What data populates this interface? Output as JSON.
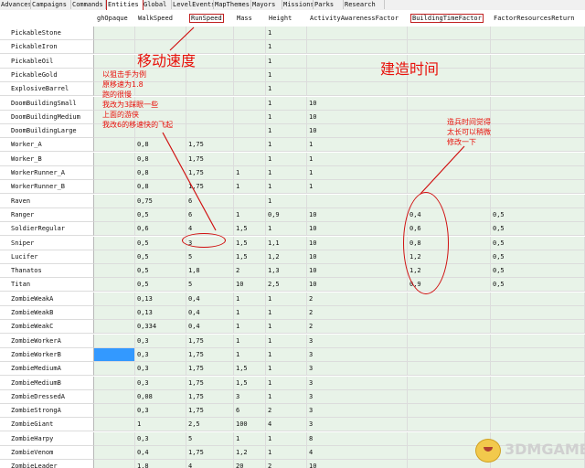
{
  "tabs": [
    "Advances",
    "Campaigns",
    "Commands",
    "Entities",
    "Global",
    "LevelEvents",
    "MapThemes",
    "Mayors",
    "Missions",
    "Parks",
    "Research"
  ],
  "active_tab": "Entities",
  "columns": [
    "ghOpaque",
    "WalkSpeed",
    "RunSpeed",
    "Mass",
    "Height",
    "ActivityAwarenessFactor",
    "BuildingTimeFactor",
    "FactorResourcesReturn"
  ],
  "rows": [
    {
      "name": "PickableStone",
      "values": [
        "",
        "",
        "",
        "",
        "1",
        "",
        "",
        ""
      ]
    },
    {
      "name": "PickableIron",
      "values": [
        "",
        "",
        "",
        "",
        "1",
        "",
        "",
        ""
      ]
    },
    {
      "name": "PickableOil",
      "values": [
        "",
        "",
        "",
        "",
        "1",
        "",
        "",
        ""
      ]
    },
    {
      "name": "PickableGold",
      "values": [
        "",
        "",
        "",
        "",
        "1",
        "",
        "",
        ""
      ]
    },
    {
      "name": "ExplosiveBarrel",
      "values": [
        "",
        "",
        "",
        "",
        "1",
        "",
        "",
        ""
      ]
    },
    {
      "name": "DoomBuildingSmall",
      "values": [
        "",
        "",
        "",
        "",
        "1",
        "10",
        "",
        ""
      ]
    },
    {
      "name": "DoomBuildingMedium",
      "values": [
        "",
        "",
        "",
        "",
        "1",
        "10",
        "",
        ""
      ]
    },
    {
      "name": "DoomBuildingLarge",
      "values": [
        "",
        "",
        "",
        "",
        "1",
        "10",
        "",
        ""
      ]
    },
    {
      "name": "Worker_A",
      "values": [
        "",
        "0,8",
        "1,75",
        "",
        "1",
        "1",
        "",
        ""
      ]
    },
    {
      "name": "Worker_B",
      "values": [
        "",
        "0,8",
        "1,75",
        "",
        "1",
        "1",
        "",
        ""
      ]
    },
    {
      "name": "WorkerRunner_A",
      "values": [
        "",
        "0,8",
        "1,75",
        "1",
        "1",
        "1",
        "",
        ""
      ]
    },
    {
      "name": "WorkerRunner_B",
      "values": [
        "",
        "0,8",
        "1,75",
        "1",
        "1",
        "1",
        "",
        ""
      ]
    },
    {
      "name": "Raven",
      "values": [
        "",
        "0,75",
        "6",
        "",
        "1",
        "",
        "",
        ""
      ]
    },
    {
      "name": "Ranger",
      "values": [
        "",
        "0,5",
        "6",
        "1",
        "0,9",
        "10",
        "0,4",
        "0,5"
      ]
    },
    {
      "name": "SoldierRegular",
      "values": [
        "",
        "0,6",
        "4",
        "1,5",
        "1",
        "10",
        "0,6",
        "0,5"
      ]
    },
    {
      "name": "Sniper",
      "values": [
        "",
        "0,5",
        "3",
        "1,5",
        "1,1",
        "10",
        "0,8",
        "0,5"
      ]
    },
    {
      "name": "Lucifer",
      "values": [
        "",
        "0,5",
        "5",
        "1,5",
        "1,2",
        "10",
        "1,2",
        "0,5"
      ]
    },
    {
      "name": "Thanatos",
      "values": [
        "",
        "0,5",
        "1,8",
        "2",
        "1,3",
        "10",
        "1,2",
        "0,5"
      ]
    },
    {
      "name": "Titan",
      "values": [
        "",
        "0,5",
        "5",
        "10",
        "2,5",
        "10",
        "0,9",
        "0,5"
      ]
    },
    {
      "name": "ZombieWeakA",
      "values": [
        "",
        "0,13",
        "0,4",
        "1",
        "1",
        "2",
        "",
        ""
      ]
    },
    {
      "name": "ZombieWeakB",
      "values": [
        "",
        "0,13",
        "0,4",
        "1",
        "1",
        "2",
        "",
        ""
      ]
    },
    {
      "name": "ZombieWeakC",
      "values": [
        "",
        "0,334",
        "0,4",
        "1",
        "1",
        "2",
        "",
        ""
      ]
    },
    {
      "name": "ZombieWorkerA",
      "values": [
        "",
        "0,3",
        "1,75",
        "1",
        "1",
        "3",
        "",
        ""
      ]
    },
    {
      "name": "ZombieWorkerB",
      "values": [
        "",
        "0,3",
        "1,75",
        "1",
        "1",
        "3",
        "",
        ""
      ]
    },
    {
      "name": "ZombieMediumA",
      "values": [
        "",
        "0,3",
        "1,75",
        "1,5",
        "1",
        "3",
        "",
        ""
      ]
    },
    {
      "name": "ZombieMediumB",
      "values": [
        "",
        "0,3",
        "1,75",
        "1,5",
        "1",
        "3",
        "",
        ""
      ]
    },
    {
      "name": "ZombieDressedA",
      "values": [
        "",
        "0,08",
        "1,75",
        "3",
        "1",
        "3",
        "",
        ""
      ]
    },
    {
      "name": "ZombieStrongA",
      "values": [
        "",
        "0,3",
        "1,75",
        "6",
        "2",
        "3",
        "",
        ""
      ]
    },
    {
      "name": "ZombieGiant",
      "values": [
        "",
        "1",
        "2,5",
        "100",
        "4",
        "3",
        "",
        ""
      ]
    },
    {
      "name": "ZombieHarpy",
      "values": [
        "",
        "0,3",
        "5",
        "1",
        "1",
        "8",
        "",
        ""
      ]
    },
    {
      "name": "ZombieVenom",
      "values": [
        "",
        "0,4",
        "1,75",
        "1,2",
        "1",
        "4",
        "",
        ""
      ]
    },
    {
      "name": "ZombieLeader",
      "values": [
        "",
        "1,8",
        "4",
        "20",
        "2",
        "10",
        "",
        ""
      ]
    }
  ],
  "selected_row": "ZombieWorkerB",
  "annotations": {
    "runspeed_title": "移动速度",
    "buildtime_title": "建造时间",
    "note_left": [
      "以狙击手为例",
      "原移速为1.8",
      "跑的很慢",
      "我改为3踩眼一些",
      "上面的游侠",
      "我改6的移速快的飞起"
    ],
    "note_right": [
      "造兵时间觉得",
      "太长可以稍微",
      "修改一下"
    ]
  },
  "watermark": "3DMGAME"
}
